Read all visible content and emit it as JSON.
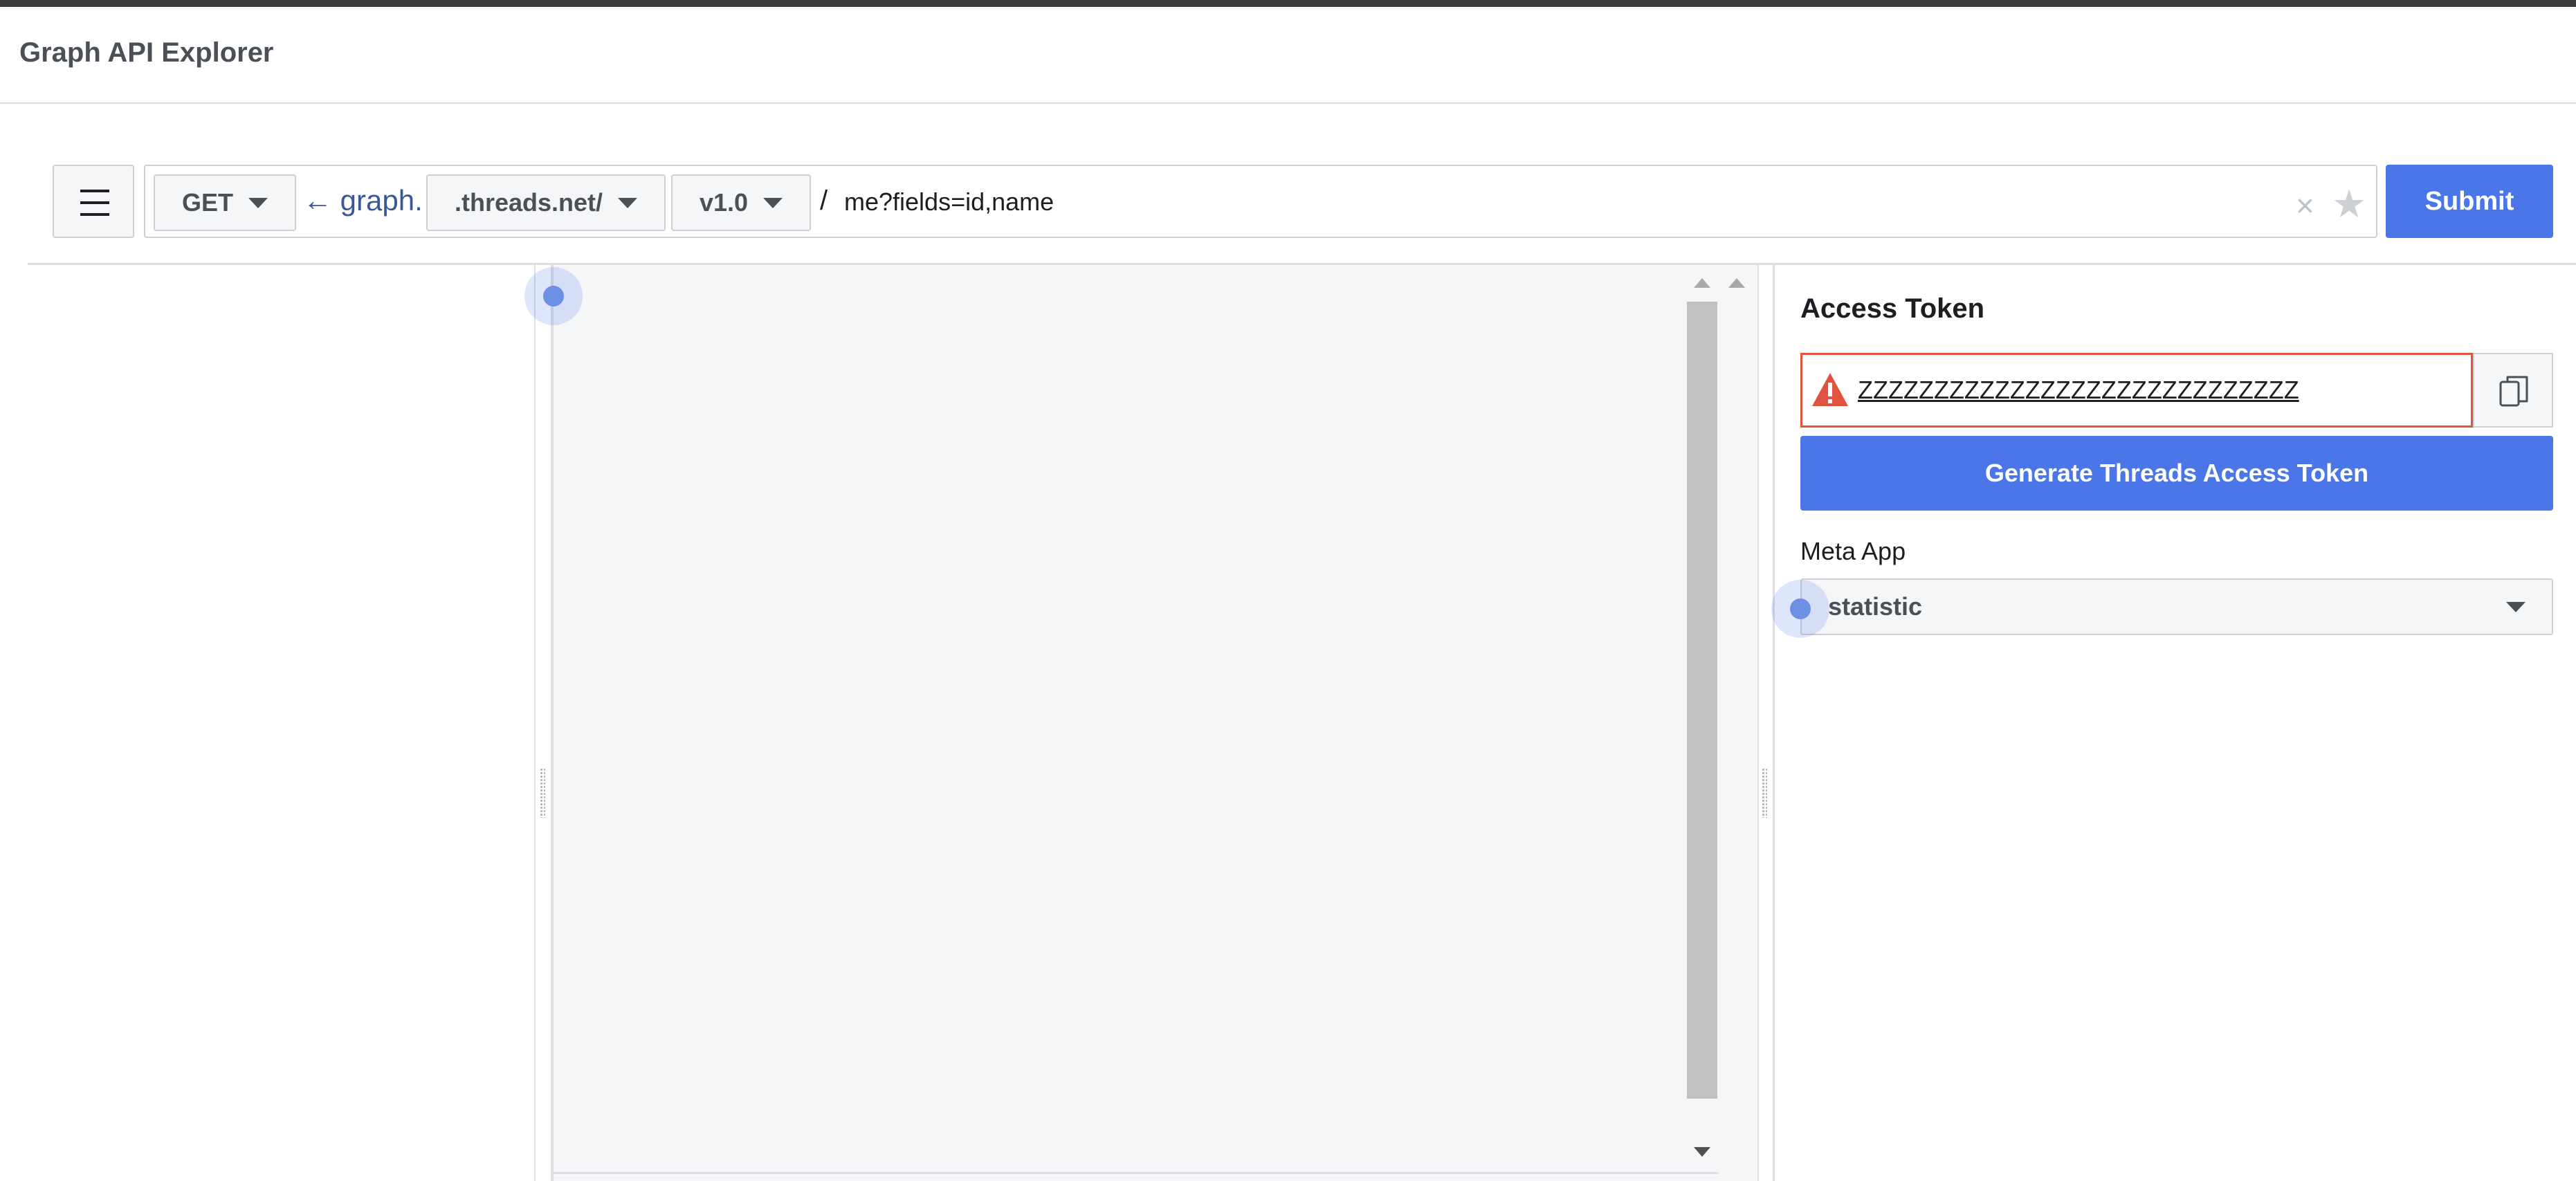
{
  "header": {
    "title": "Graph API Explorer"
  },
  "query": {
    "method": "GET",
    "graph_prefix": "← graph.",
    "domain": ".threads.net/",
    "version": "v1.0",
    "separator": "/",
    "path": "me?fields=id,name",
    "clear_glyph": "×",
    "star_glyph": "★",
    "submit_label": "Submit"
  },
  "sidebar": {
    "access_token_heading": "Access Token",
    "access_token_value": "ZZZZZZZZZZZZZZZZZZZZZZZZZZZZZ",
    "generate_label": "Generate Threads Access Token",
    "meta_app_label": "Meta App",
    "meta_app_value": "statistic"
  },
  "icons": {
    "menu": "hamburger-menu-icon",
    "clear": "close-icon",
    "favorite": "star-icon",
    "warning": "warning-icon",
    "copy": "copy-icon",
    "dropdown": "caret-down-icon"
  },
  "colors": {
    "primary": "#4a76e8",
    "error": "#e0533f",
    "link": "#385898",
    "pane_background": "#f5f6f7"
  }
}
